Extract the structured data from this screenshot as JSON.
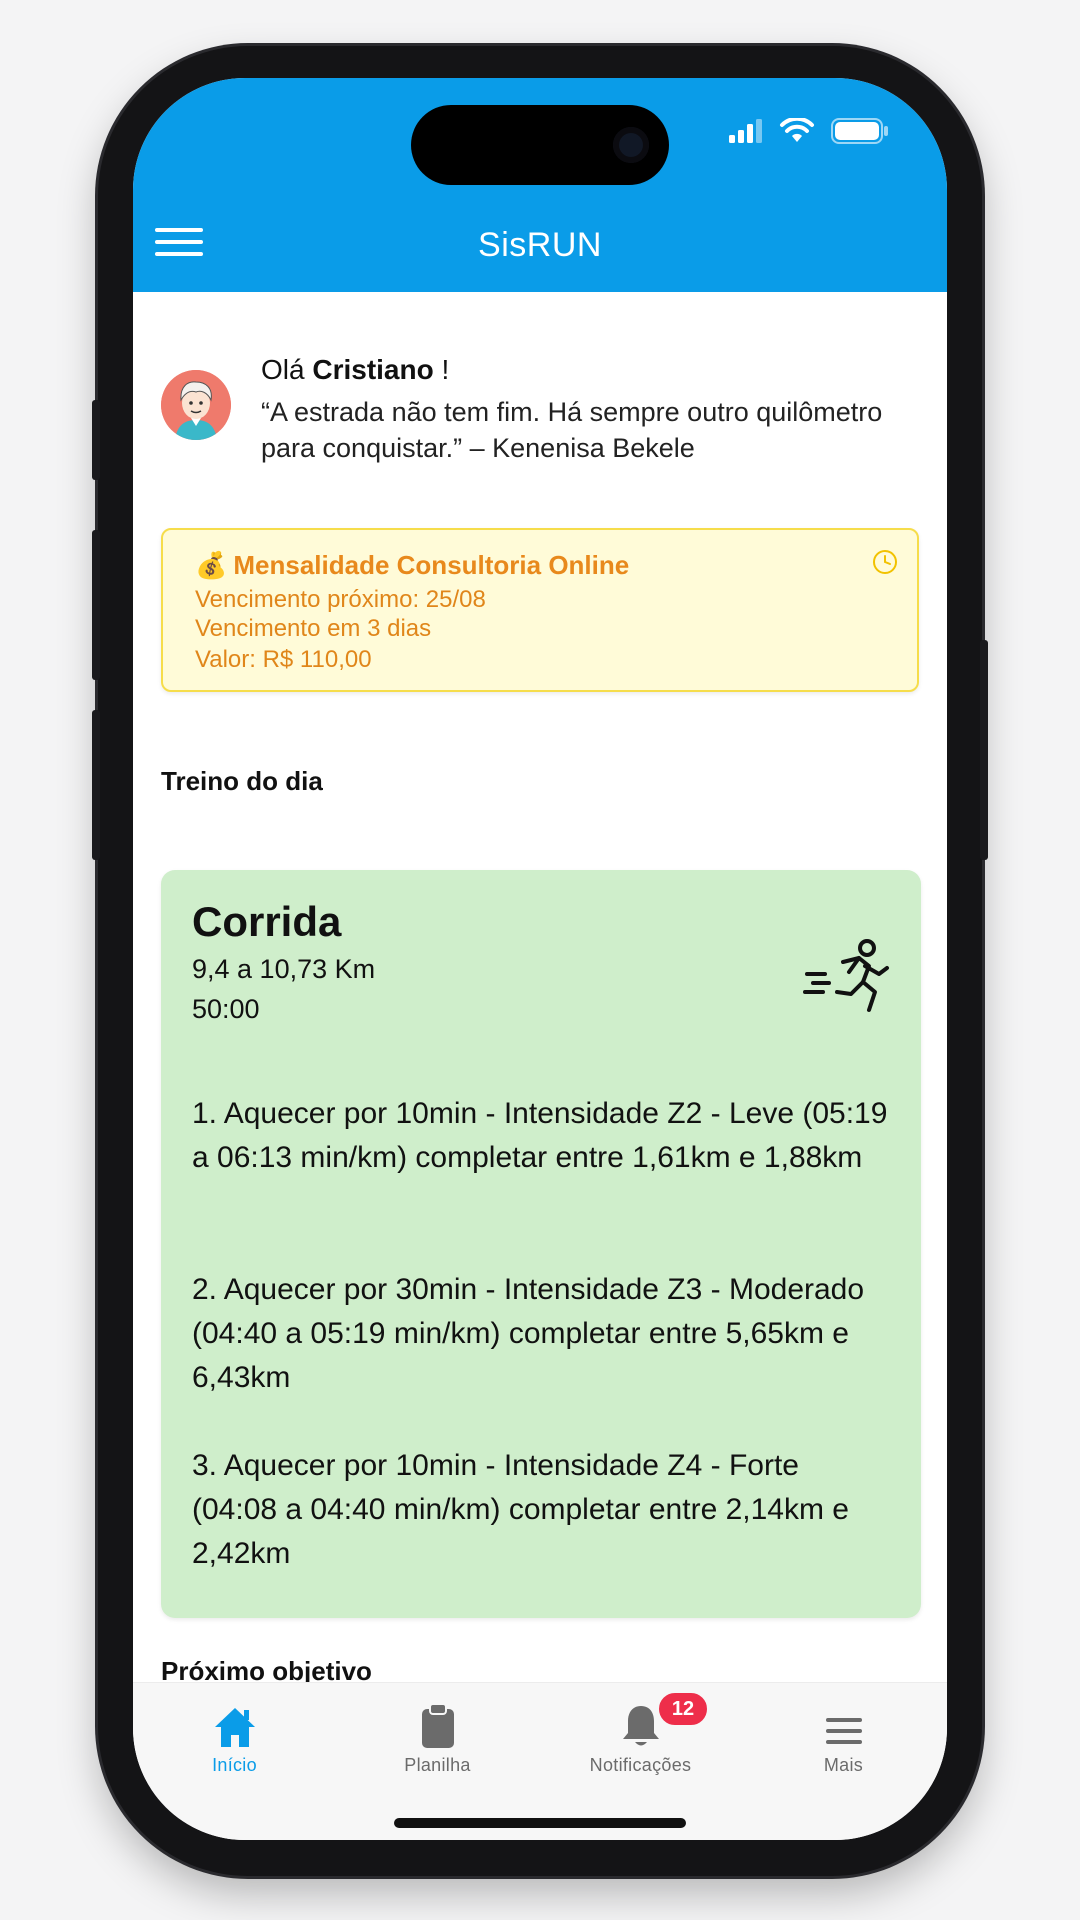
{
  "app": {
    "title": "SisRUN",
    "accent_color": "#0a9ce8"
  },
  "greeting": {
    "hello_prefix": "Olá ",
    "user_name": "Cristiano",
    "hello_suffix": " !",
    "quote": "“A estrada não tem fim. Há sempre outro quilômetro para conquistar.” – Kenenisa Bekele"
  },
  "payment_alert": {
    "emoji": "💰",
    "title": "Mensalidade Consultoria Online",
    "due_next": "Vencimento próximo: 25/08",
    "due_in": "Vencimento em 3 dias",
    "amount": "Valor: R$ 110,00"
  },
  "workout_section": {
    "title": "Treino do dia",
    "workout": {
      "type": "Corrida",
      "distance": "9,4 a 10,73 Km",
      "duration": "50:00",
      "steps": [
        "1. Aquecer por 10min - Intensidade Z2 - Leve (05:19 a 06:13 min/km) completar entre 1,61km e 1,88km",
        "2. Aquecer por 30min - Intensidade Z3 - Moderado (04:40 a 05:19 min/km) completar entre 5,65km e 6,43km",
        "3. Aquecer por 10min - Intensidade Z4 - Forte (04:08 a 04:40 min/km) completar entre 2,14km e 2,42km"
      ]
    }
  },
  "next_goal_section": {
    "title": "Próximo objetivo"
  },
  "tabbar": {
    "tabs": [
      {
        "label": "Início",
        "icon": "home-icon",
        "active": true
      },
      {
        "label": "Planilha",
        "icon": "clipboard-icon",
        "active": false
      },
      {
        "label": "Notificações",
        "icon": "bell-icon",
        "active": false,
        "badge": "12"
      },
      {
        "label": "Mais",
        "icon": "menu-icon",
        "active": false
      }
    ]
  }
}
